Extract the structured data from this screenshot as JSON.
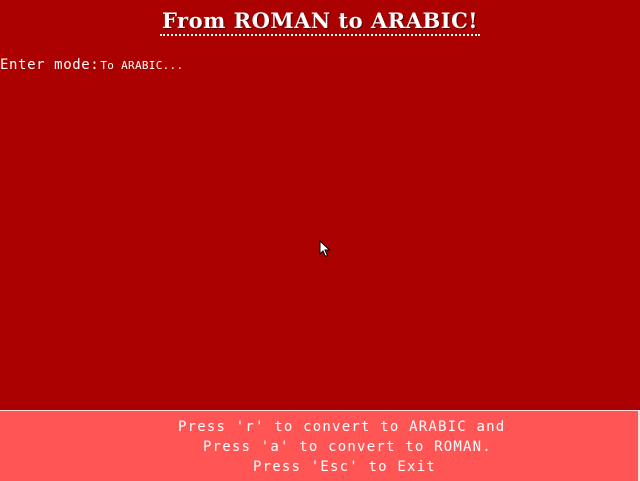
{
  "title": "From ROMAN to ARABIC!",
  "mode": {
    "label": "Enter mode:",
    "value": "To ARABIC..."
  },
  "footer": {
    "line1": "Press 'r' to convert to ARABIC and",
    "line2": "Press 'a' to convert to ROMAN.",
    "line3": "Press 'Esc' to Exit"
  },
  "icons": {
    "cursor": "mouse-pointer-icon"
  },
  "colors": {
    "background": "#aa0000",
    "footer_background": "#ff5555",
    "text": "#ffffff"
  }
}
